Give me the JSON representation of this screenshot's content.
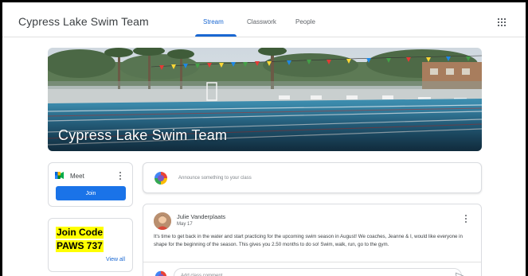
{
  "header": {
    "class_title": "Cypress Lake Swim Team",
    "tabs": [
      {
        "label": "Stream",
        "active": true
      },
      {
        "label": "Classwork",
        "active": false
      },
      {
        "label": "People",
        "active": false
      }
    ],
    "apps_icon": "apps-grid-icon"
  },
  "banner": {
    "title": "Cypress Lake Swim Team",
    "image": "swimming-pool-photo"
  },
  "meet": {
    "label": "Meet",
    "join_label": "Join",
    "icon": "google-meet-icon"
  },
  "class_code": {
    "line1": "Join Code",
    "line2": "PAWS 737",
    "view_all": "View all"
  },
  "announce": {
    "placeholder": "Announce something to your class"
  },
  "post": {
    "author": "Julie Vanderplaats",
    "date": "May 17",
    "body": "It's time to get back in the water and start practicing for the upcoming swim season in August!  We coaches, Jeanne & I, would like everyone in shape for the beginning of the season.  This gives you 2.50 months to do so! Swim, walk, run, go to the gym.",
    "comment_placeholder": "Add class comment..."
  },
  "colors": {
    "accent": "#1967d2",
    "join_button": "#1a73e8",
    "highlight": "#ffff00"
  }
}
